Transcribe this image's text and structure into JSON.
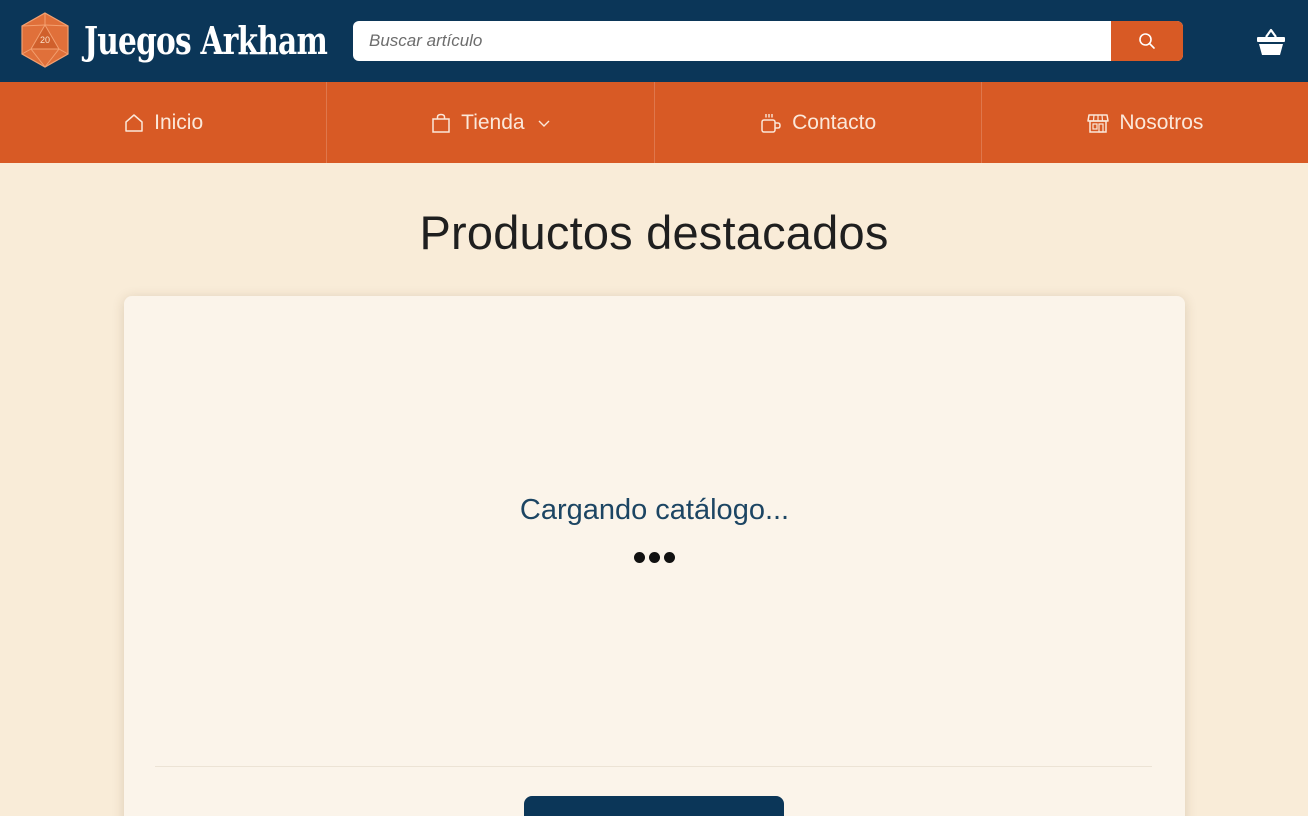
{
  "header": {
    "brand_name": "Juegos Arkham",
    "brand_die_label": "20",
    "search": {
      "placeholder": "Buscar artículo",
      "value": ""
    },
    "colors": {
      "header_bg": "#0b3658",
      "accent": "#d85a25",
      "page_bg": "#f9ecd8"
    }
  },
  "nav": {
    "items": [
      {
        "label": "Inicio",
        "icon": "home-icon"
      },
      {
        "label": "Tienda",
        "icon": "shopping-bag-icon",
        "has_dropdown": true
      },
      {
        "label": "Contacto",
        "icon": "coffee-cup-icon"
      },
      {
        "label": "Nosotros",
        "icon": "storefront-icon"
      }
    ]
  },
  "main": {
    "title": "Productos destacados",
    "loading_text": "Cargando catálogo...",
    "loading_indicator": "•••"
  }
}
